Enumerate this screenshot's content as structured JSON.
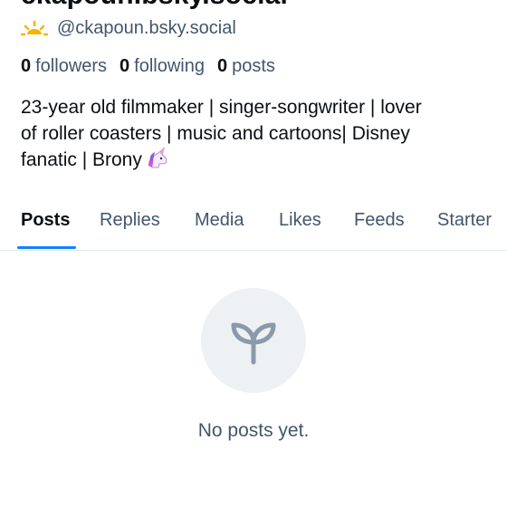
{
  "profile": {
    "display_name": "ckapoun.bsky.social",
    "handle": "@ckapoun.bsky.social",
    "stats": [
      {
        "count": "0",
        "label": "followers"
      },
      {
        "count": "0",
        "label": "following"
      },
      {
        "count": "0",
        "label": "posts"
      }
    ],
    "bio": {
      "line1": "23-year old filmmaker | singer-songwriter | lover",
      "line2": "of roller coasters | music and cartoons| Disney",
      "line3": "fanatic | Brony"
    }
  },
  "tabs": [
    {
      "label": "Posts"
    },
    {
      "label": "Replies"
    },
    {
      "label": "Media"
    },
    {
      "label": "Likes"
    },
    {
      "label": "Feeds"
    },
    {
      "label": "Starter"
    }
  ],
  "empty_state": {
    "message": "No posts yet.",
    "icon": "sprout-icon"
  },
  "colors": {
    "accent": "#1083fe",
    "muted_text": "#42566b",
    "icon_bg": "#eef1f4",
    "icon_stroke": "#8a9aab"
  }
}
